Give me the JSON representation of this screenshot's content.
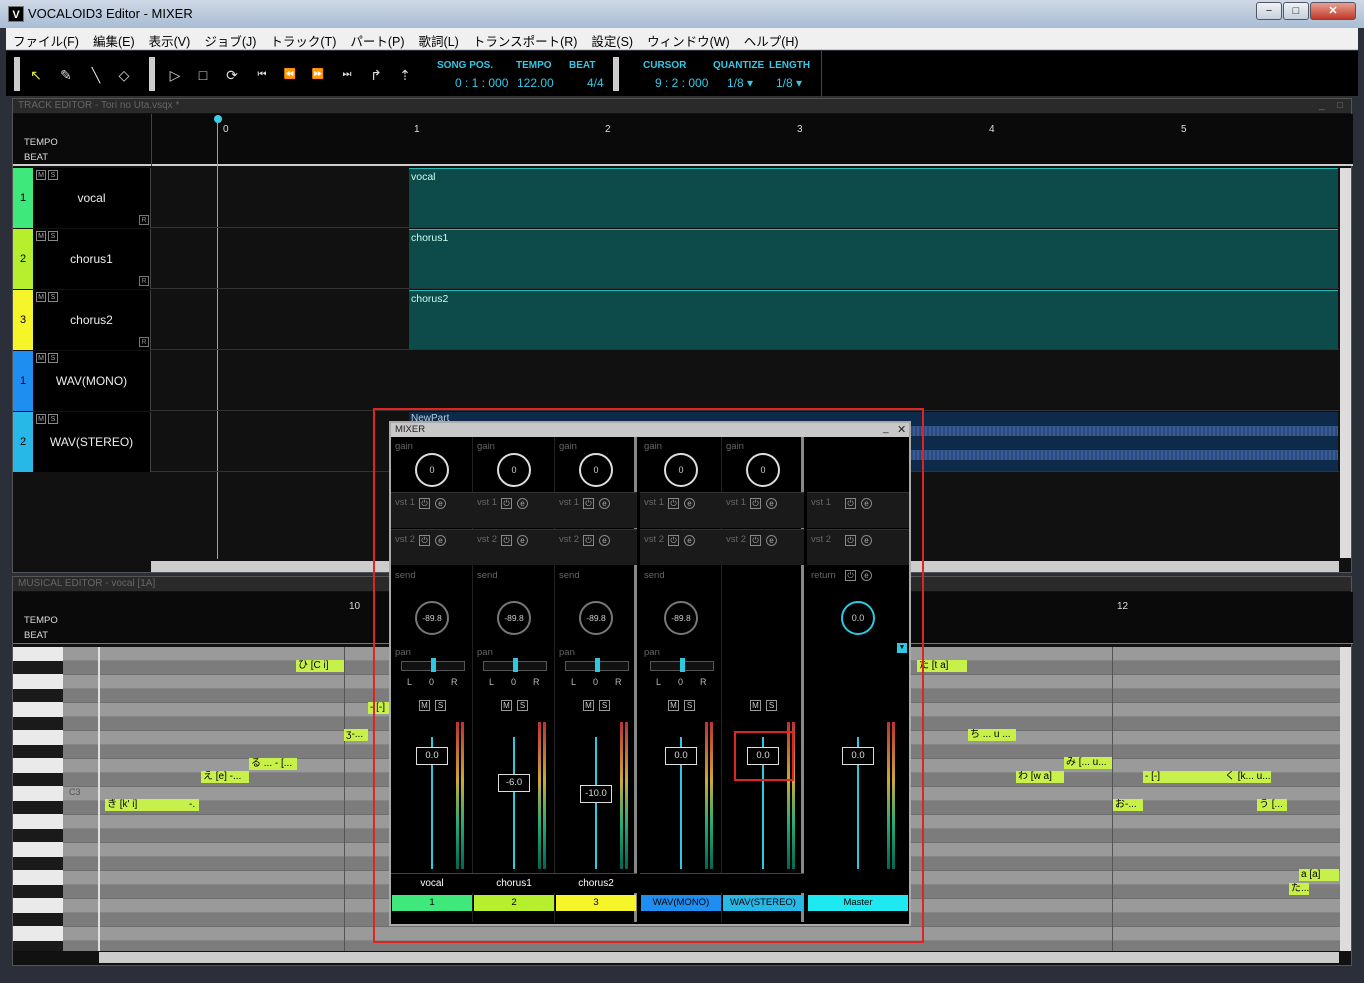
{
  "window": {
    "title": "VOCALOID3 Editor - MIXER",
    "icon": "V",
    "min": "−",
    "max": "□",
    "close": "✕"
  },
  "menu": [
    "ファイル(F)",
    "編集(E)",
    "表示(V)",
    "ジョブ(J)",
    "トラック(T)",
    "パート(P)",
    "歌詞(L)",
    "トランスポート(R)",
    "設定(S)",
    "ウィンドウ(W)",
    "ヘルプ(H)"
  ],
  "toolbar": {
    "song_pos_label": "SONG POS.",
    "song_pos": "0 : 1 : 000",
    "tempo_label": "TEMPO",
    "tempo": "122.00",
    "beat_label": "BEAT",
    "beat": "4/4",
    "cursor_label": "CURSOR",
    "cursor": "9 : 2 : 000",
    "quantize_label": "QUANTIZE",
    "quantize": "1/8 ▾",
    "length_label": "LENGTH",
    "length": "1/8 ▾"
  },
  "track_editor": {
    "title": "TRACK EDITOR - Tori no Uta.vsqx *",
    "tempo_label": "TEMPO",
    "beat_label": "BEAT",
    "ruler": [
      "0",
      "1",
      "2",
      "3",
      "4",
      "5"
    ],
    "tracks": [
      {
        "num": "1",
        "name": "vocal",
        "color": "#3ee87a",
        "part": "vocal"
      },
      {
        "num": "2",
        "name": "chorus1",
        "color": "#b5ef2e",
        "part": "chorus1"
      },
      {
        "num": "3",
        "name": "chorus2",
        "color": "#f5f52a",
        "part": "chorus2"
      },
      {
        "num": "1",
        "name": "WAV(MONO)",
        "color": "#1e8ff0",
        "part": ""
      },
      {
        "num": "2",
        "name": "WAV(STEREO)",
        "color": "#28b8e8",
        "part": "NewPart"
      }
    ],
    "m": "M",
    "s": "S",
    "r": "R"
  },
  "musical_editor": {
    "title": "MUSICAL EDITOR - vocal [1A]",
    "tempo_label": "TEMPO",
    "beat_label": "BEAT",
    "ruler": [
      "10",
      "12"
    ],
    "c3": "C3",
    "notes": [
      {
        "text": "ひ [C i]"
      },
      {
        "text": "- [-]"
      },
      {
        "text": "ʒ-..."
      },
      {
        "text": "る ... - [..."
      },
      {
        "text": "え [e] -..."
      },
      {
        "text": "き [k' i]"
      },
      {
        "text": "-."
      },
      {
        "text": "た [t a]"
      },
      {
        "text": "ち ... u ..."
      },
      {
        "text": "み [... u..."
      },
      {
        "text": "わ [w a]"
      },
      {
        "text": "- [-]"
      },
      {
        "text": "く [k... u..."
      },
      {
        "text": "お-..."
      },
      {
        "text": "う [..."
      },
      {
        "text": "a [a]"
      },
      {
        "text": "た..."
      }
    ]
  },
  "mixer": {
    "title": "MIXER",
    "gain_label": "gain",
    "vst1_label": "vst 1",
    "vst2_label": "vst 2",
    "send_label": "send",
    "return_label": "return",
    "pan_label": "pan",
    "l": "L",
    "r": "R",
    "m": "M",
    "s": "S",
    "strips": [
      {
        "gain": "0",
        "send": "-89.8",
        "pan": "0",
        "fader": "0.0",
        "name": "vocal",
        "tag": "1",
        "color": "#3ee87a"
      },
      {
        "gain": "0",
        "send": "-89.8",
        "pan": "0",
        "fader": "-6.0",
        "name": "chorus1",
        "tag": "2",
        "color": "#b5ef2e"
      },
      {
        "gain": "0",
        "send": "-89.8",
        "pan": "0",
        "fader": "-10.0",
        "name": "chorus2",
        "tag": "3",
        "color": "#f5f52a"
      },
      {
        "gain": "0",
        "send": "-89.8",
        "pan": "0",
        "fader": "0.0",
        "name": "",
        "tag": "WAV(MONO)",
        "color": "#1e8ff0"
      },
      {
        "gain": "0",
        "send": "",
        "pan": "",
        "fader": "0.0",
        "name": "",
        "tag": "WAV(STEREO)",
        "color": "#28b8e8"
      }
    ],
    "master": {
      "return": "0.0",
      "fader": "0.0",
      "tag": "Master",
      "color": "#1ee8f0"
    }
  }
}
